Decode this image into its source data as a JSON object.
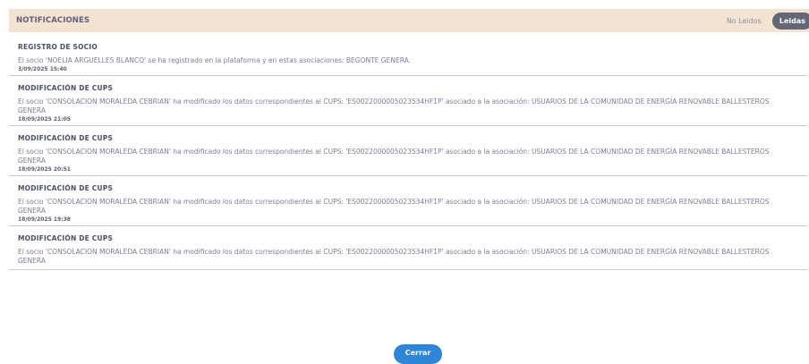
{
  "header": {
    "title": "NOTIFICACIONES",
    "filter_unread": "No Leidos",
    "filter_read": "Leidas"
  },
  "notifications": [
    {
      "title": "REGISTRO DE SOCIO",
      "body": "El socio 'NOELIA ARGUELLES BLANCO' se ha registrado en la plataforma y en estas asociaciones: BEGONTE GENERA.",
      "date": "3/09/2025 15:40"
    },
    {
      "title": "MODIFICACIÓN DE CUPS",
      "body": "El socio 'CONSOLACION MORALEDA CEBRIAN' ha modificado los datos correspondientes al CUPS: 'ES0022000005023534HF1P' asociado a la asociación: USUARIOS DE LA COMUNIDAD DE ENERGÍA RENOVABLE BALLESTEROS GENERA",
      "date": "18/09/2025 21:05"
    },
    {
      "title": "MODIFICACIÓN DE CUPS",
      "body": "El socio 'CONSOLACION MORALEDA CEBRIAN' ha modificado los datos correspondientes al CUPS: 'ES0022000005023534HF1P' asociado a la asociación: USUARIOS DE LA COMUNIDAD DE ENERGÍA RENOVABLE BALLESTEROS GENERA",
      "date": "18/09/2025 20:51"
    },
    {
      "title": "MODIFICACIÓN DE CUPS",
      "body": "El socio 'CONSOLACION MORALEDA CEBRIAN' ha modificado los datos correspondientes al CUPS: 'ES0022000005023534HF1P' asociado a la asociación: USUARIOS DE LA COMUNIDAD DE ENERGÍA RENOVABLE BALLESTEROS GENERA",
      "date": "18/09/2025 19:38"
    },
    {
      "title": "MODIFICACIÓN DE CUPS",
      "body": "El socio 'CONSOLACION MORALEDA CEBRIAN' ha modificado los datos correspondientes al CUPS: 'ES0022000005023534HF1P' asociado a la asociación: USUARIOS DE LA COMUNIDAD DE ENERGÍA RENOVABLE BALLESTEROS GENERA",
      "date": ""
    }
  ],
  "footer": {
    "close_label": "Cerrar"
  },
  "colors": {
    "header_bg": "#f3e3d3",
    "active_filter_bg": "#626677",
    "close_button_bg": "#2f86d6"
  }
}
